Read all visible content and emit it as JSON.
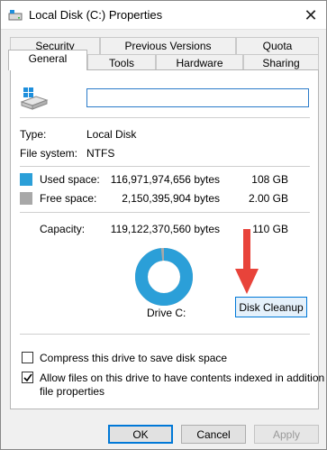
{
  "window": {
    "title": "Local Disk (C:) Properties",
    "close_glyph": "✕",
    "icon": "drive-icon"
  },
  "tabs": {
    "row1": [
      "Security",
      "Previous Versions",
      "Quota"
    ],
    "row2": [
      "General",
      "Tools",
      "Hardware",
      "Sharing"
    ],
    "active": "General"
  },
  "general": {
    "volume_label": "",
    "type_label": "Type:",
    "type_value": "Local Disk",
    "fs_label": "File system:",
    "fs_value": "NTFS",
    "used_label": "Used space:",
    "used_bytes": "116,971,974,656 bytes",
    "used_size": "108 GB",
    "free_label": "Free space:",
    "free_bytes": "2,150,395,904 bytes",
    "free_size": "2.00 GB",
    "capacity_label": "Capacity:",
    "capacity_bytes": "119,122,370,560 bytes",
    "capacity_size": "110 GB",
    "drive_label": "Drive C:",
    "cleanup_label": "Disk Cleanup",
    "used_fraction": 0.982,
    "compress_label": "Compress this drive to save disk space",
    "compress_checked": false,
    "index_label_line1": "Allow files on this drive to have contents indexed in addition to",
    "index_label_line2": "file properties",
    "index_checked": true
  },
  "colors": {
    "used": "#2b9fd8",
    "free": "#a8a8a8",
    "accent": "#0078d7",
    "annotation_arrow": "#e8433a"
  },
  "buttons": {
    "ok": "OK",
    "cancel": "Cancel",
    "apply": "Apply",
    "apply_enabled": false
  }
}
